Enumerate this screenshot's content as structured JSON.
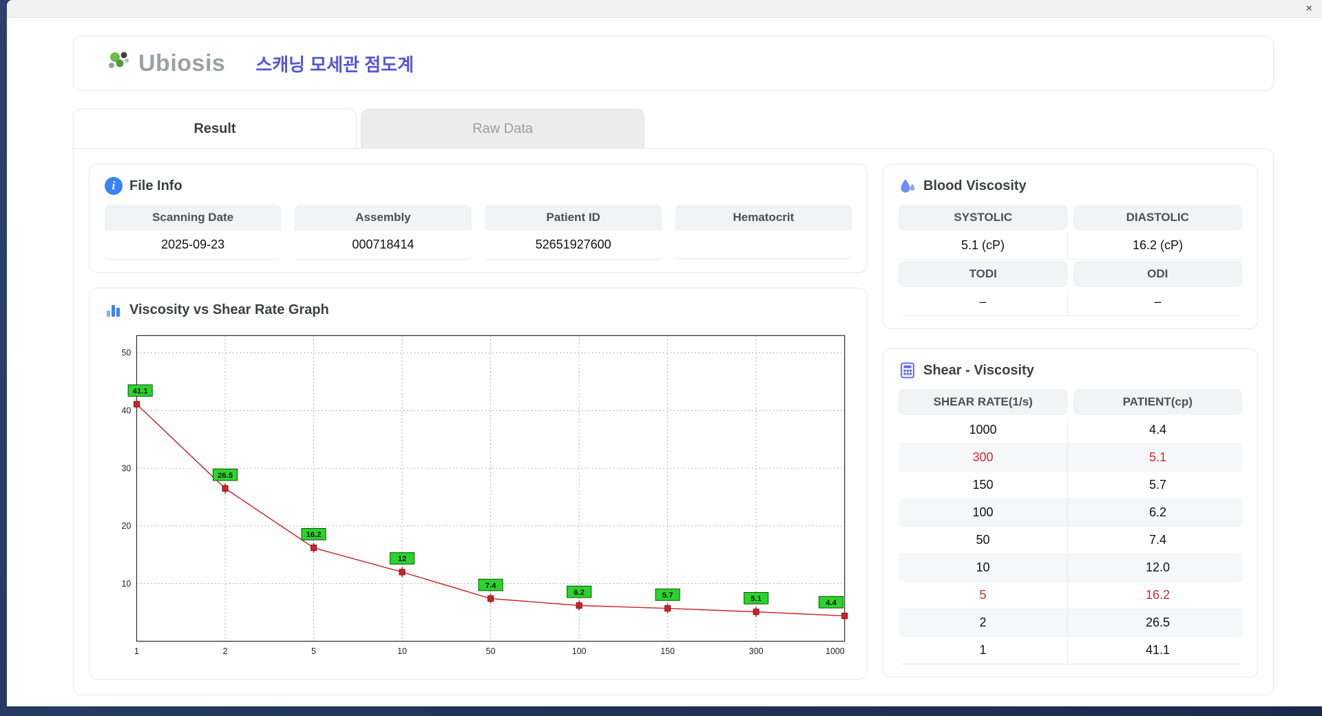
{
  "window": {
    "close_label": "×"
  },
  "header": {
    "logo_text": "Ubiosis",
    "title": "스캐닝 모세관 점도계"
  },
  "tabs": {
    "result": "Result",
    "raw_data": "Raw Data"
  },
  "file_info": {
    "title": "File Info",
    "fields": [
      {
        "label": "Scanning Date",
        "value": "2025-09-23"
      },
      {
        "label": "Assembly",
        "value": "000718414"
      },
      {
        "label": "Patient ID",
        "value": "52651927600"
      },
      {
        "label": "Hematocrit",
        "value": ""
      }
    ]
  },
  "graph": {
    "title": "Viscosity vs Shear Rate Graph"
  },
  "chart_data": {
    "type": "line",
    "title": "Viscosity vs Shear Rate Graph",
    "xlabel": "",
    "ylabel": "",
    "x_categories": [
      "1",
      "2",
      "5",
      "10",
      "50",
      "100",
      "150",
      "300",
      "1000"
    ],
    "values": [
      41.1,
      26.5,
      16.2,
      12,
      7.4,
      6.2,
      5.7,
      5.1,
      4.4
    ],
    "point_labels": [
      "41.1",
      "26.5",
      "16.2",
      "12",
      "7.4",
      "6.2",
      "5.7",
      "5.1",
      "4.4"
    ],
    "ylim": [
      0,
      53
    ],
    "yticks": [
      10,
      20,
      30,
      40,
      50
    ],
    "grid": "dotted",
    "legend": "none",
    "line_color": "#c8242b",
    "marker_color": "#c8242b",
    "label_bg": "#2bd42b",
    "label_border": "#0a5a0a"
  },
  "blood_viscosity": {
    "title": "Blood Viscosity",
    "systolic_label": "SYSTOLIC",
    "diastolic_label": "DIASTOLIC",
    "systolic_value": "5.1 (cP)",
    "diastolic_value": "16.2 (cP)",
    "todi_label": "TODI",
    "odi_label": "ODI",
    "todi_value": "–",
    "odi_value": "–"
  },
  "shear_viscosity": {
    "title": "Shear - Viscosity",
    "col1": "SHEAR RATE(1/s)",
    "col2": "PATIENT(cp)",
    "rows": [
      {
        "rate": "1000",
        "patient": "4.4",
        "highlight": false
      },
      {
        "rate": "300",
        "patient": "5.1",
        "highlight": true
      },
      {
        "rate": "150",
        "patient": "5.7",
        "highlight": false
      },
      {
        "rate": "100",
        "patient": "6.2",
        "highlight": false
      },
      {
        "rate": "50",
        "patient": "7.4",
        "highlight": false
      },
      {
        "rate": "10",
        "patient": "12.0",
        "highlight": false
      },
      {
        "rate": "5",
        "patient": "16.2",
        "highlight": true
      },
      {
        "rate": "2",
        "patient": "26.5",
        "highlight": false
      },
      {
        "rate": "1",
        "patient": "41.1",
        "highlight": false
      }
    ]
  },
  "colors": {
    "accent_blue": "#3b82f6",
    "title_indigo": "#5156d6",
    "alert_red": "#d52b2b",
    "label_green": "#2bd42b"
  }
}
